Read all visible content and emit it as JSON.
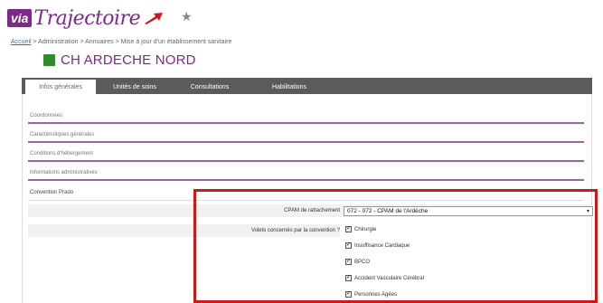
{
  "logo": {
    "via": "via",
    "name": "Trajectoire"
  },
  "header": {
    "star_icon": "star-icon"
  },
  "breadcrumb": {
    "home": "Accueil",
    "rest": " > Administration > Annuaires > Mise à jour d'un établissement sanitaire"
  },
  "page": {
    "title": "CH ARDECHE NORD"
  },
  "tabs": [
    {
      "label": "Infos générales",
      "active": true
    },
    {
      "label": "Unités de soins",
      "active": false
    },
    {
      "label": "Consultations",
      "active": false
    },
    {
      "label": "Habilitations",
      "active": false
    }
  ],
  "sections": [
    {
      "label": "Coordonnées"
    },
    {
      "label": "Caractéristiques générales"
    },
    {
      "label": "Conditions d'hébergement"
    },
    {
      "label": "Informations administratives"
    },
    {
      "label": "Convention Prado"
    }
  ],
  "form": {
    "cpam_label": "CPAM de rattachement",
    "cpam_value": "072 - 072 - CPAM de l'Ardèche",
    "volets_label": "Volets concernés par la convention ?",
    "volets": [
      {
        "label": "Chirurgie",
        "checked": true
      },
      {
        "label": "Insuffisance Cardiaque",
        "checked": true
      },
      {
        "label": "BPCO",
        "checked": true
      },
      {
        "label": "Accident Vasculaire Cérébral",
        "checked": true
      },
      {
        "label": "Personnes Agées",
        "checked": true
      }
    ]
  },
  "colors": {
    "brand": "#7b2a8a",
    "highlight": "#d01818",
    "tabbar": "#5b5b5b"
  }
}
